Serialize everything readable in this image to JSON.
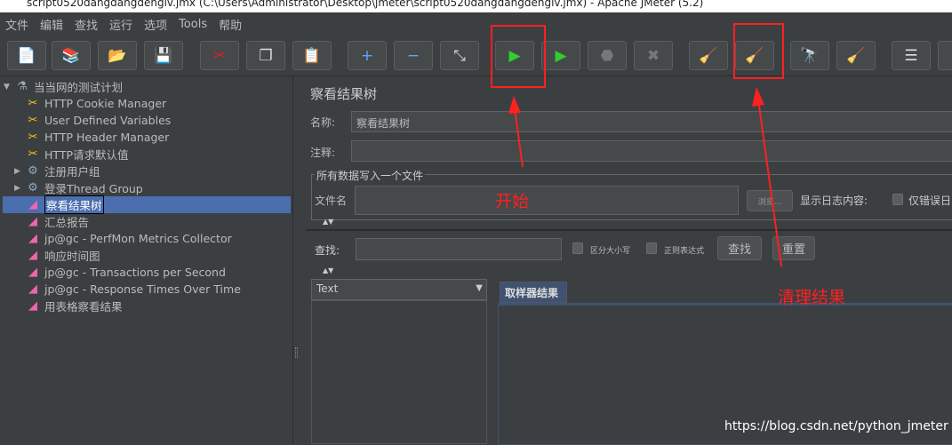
{
  "window": {
    "title": "script0520dangdangdenglv.jmx (C:\\Users\\Administrator\\Desktop\\jmeter\\script0520dangdangdenglv.jmx) - Apache JMeter (5.2)"
  },
  "menu": [
    "文件",
    "编辑",
    "查找",
    "运行",
    "选项",
    "Tools",
    "帮助"
  ],
  "toolbar": [
    {
      "icon": "new-icon",
      "g": "📄"
    },
    {
      "icon": "templates-icon",
      "g": "📚"
    },
    {
      "icon": "open-icon",
      "g": "📂"
    },
    {
      "icon": "save-icon",
      "g": "💾"
    },
    {
      "icon": "cut-icon",
      "g": "✂"
    },
    {
      "icon": "copy-icon",
      "g": "❐"
    },
    {
      "icon": "paste-icon",
      "g": "📋"
    },
    {
      "icon": "expand-icon",
      "g": "+"
    },
    {
      "icon": "collapse-icon",
      "g": "−"
    },
    {
      "icon": "toggle-icon",
      "g": "⤡"
    },
    {
      "icon": "start-icon",
      "g": "▶"
    },
    {
      "icon": "start-no-pause-icon",
      "g": "▶"
    },
    {
      "icon": "stop-icon",
      "g": "⬣"
    },
    {
      "icon": "shutdown-icon",
      "g": "✖"
    },
    {
      "icon": "clear-icon",
      "g": "🧹"
    },
    {
      "icon": "clear-all-icon",
      "g": "🧹"
    },
    {
      "icon": "search-icon",
      "g": "🔭"
    },
    {
      "icon": "reset-search-icon",
      "g": "🧹"
    },
    {
      "icon": "function-helper-icon",
      "g": "☰"
    },
    {
      "icon": "help-icon",
      "g": "?"
    }
  ],
  "tree": [
    {
      "label": "当当网的测试计划",
      "icon": "test-plan-icon",
      "level": 0,
      "arrow": "▼"
    },
    {
      "label": "HTTP Cookie Manager",
      "icon": "config-icon",
      "level": 1
    },
    {
      "label": "User Defined Variables",
      "icon": "config-icon",
      "level": 1
    },
    {
      "label": "HTTP Header Manager",
      "icon": "config-icon",
      "level": 1
    },
    {
      "label": "HTTP请求默认值",
      "icon": "config-icon",
      "level": 1
    },
    {
      "label": "注册用户组",
      "icon": "thread-group-icon",
      "level": 1,
      "arrow": "▶"
    },
    {
      "label": "登录Thread Group",
      "icon": "thread-group-icon",
      "level": 1,
      "arrow": "▶"
    },
    {
      "label": "察看结果树",
      "icon": "listener-icon",
      "level": 1,
      "selected": true
    },
    {
      "label": "汇总报告",
      "icon": "listener-icon",
      "level": 1
    },
    {
      "label": "jp@gc - PerfMon Metrics Collector",
      "icon": "listener-icon",
      "level": 1
    },
    {
      "label": "响应时间图",
      "icon": "listener-icon",
      "level": 1
    },
    {
      "label": "jp@gc - Transactions per Second",
      "icon": "listener-icon",
      "level": 1
    },
    {
      "label": "jp@gc - Response Times Over Time",
      "icon": "listener-icon",
      "level": 1
    },
    {
      "label": "用表格察看结果",
      "icon": "listener-icon",
      "level": 1
    }
  ],
  "panel": {
    "title": "察看结果树",
    "name_label": "名称:",
    "name_value": "察看结果树",
    "comment_label": "注释:",
    "comment_value": "",
    "file_group": "所有数据写入一个文件",
    "filename_label": "文件名",
    "filename_value": "",
    "browse": "浏览...",
    "log_label": "显示日志内容:",
    "errors_only": "仅错误日",
    "search_label": "查找:",
    "search_value": "",
    "case_sensitive": "区分大小写",
    "regex": "正则表达式",
    "find_button": "查找",
    "reset_button": "重置",
    "renderer": "Text",
    "tab": "取样器结果"
  },
  "annotations": {
    "start": "开始",
    "clear": "清理结果",
    "color": "#ff2020"
  },
  "watermark": "https://blog.csdn.net/python_jmeter"
}
